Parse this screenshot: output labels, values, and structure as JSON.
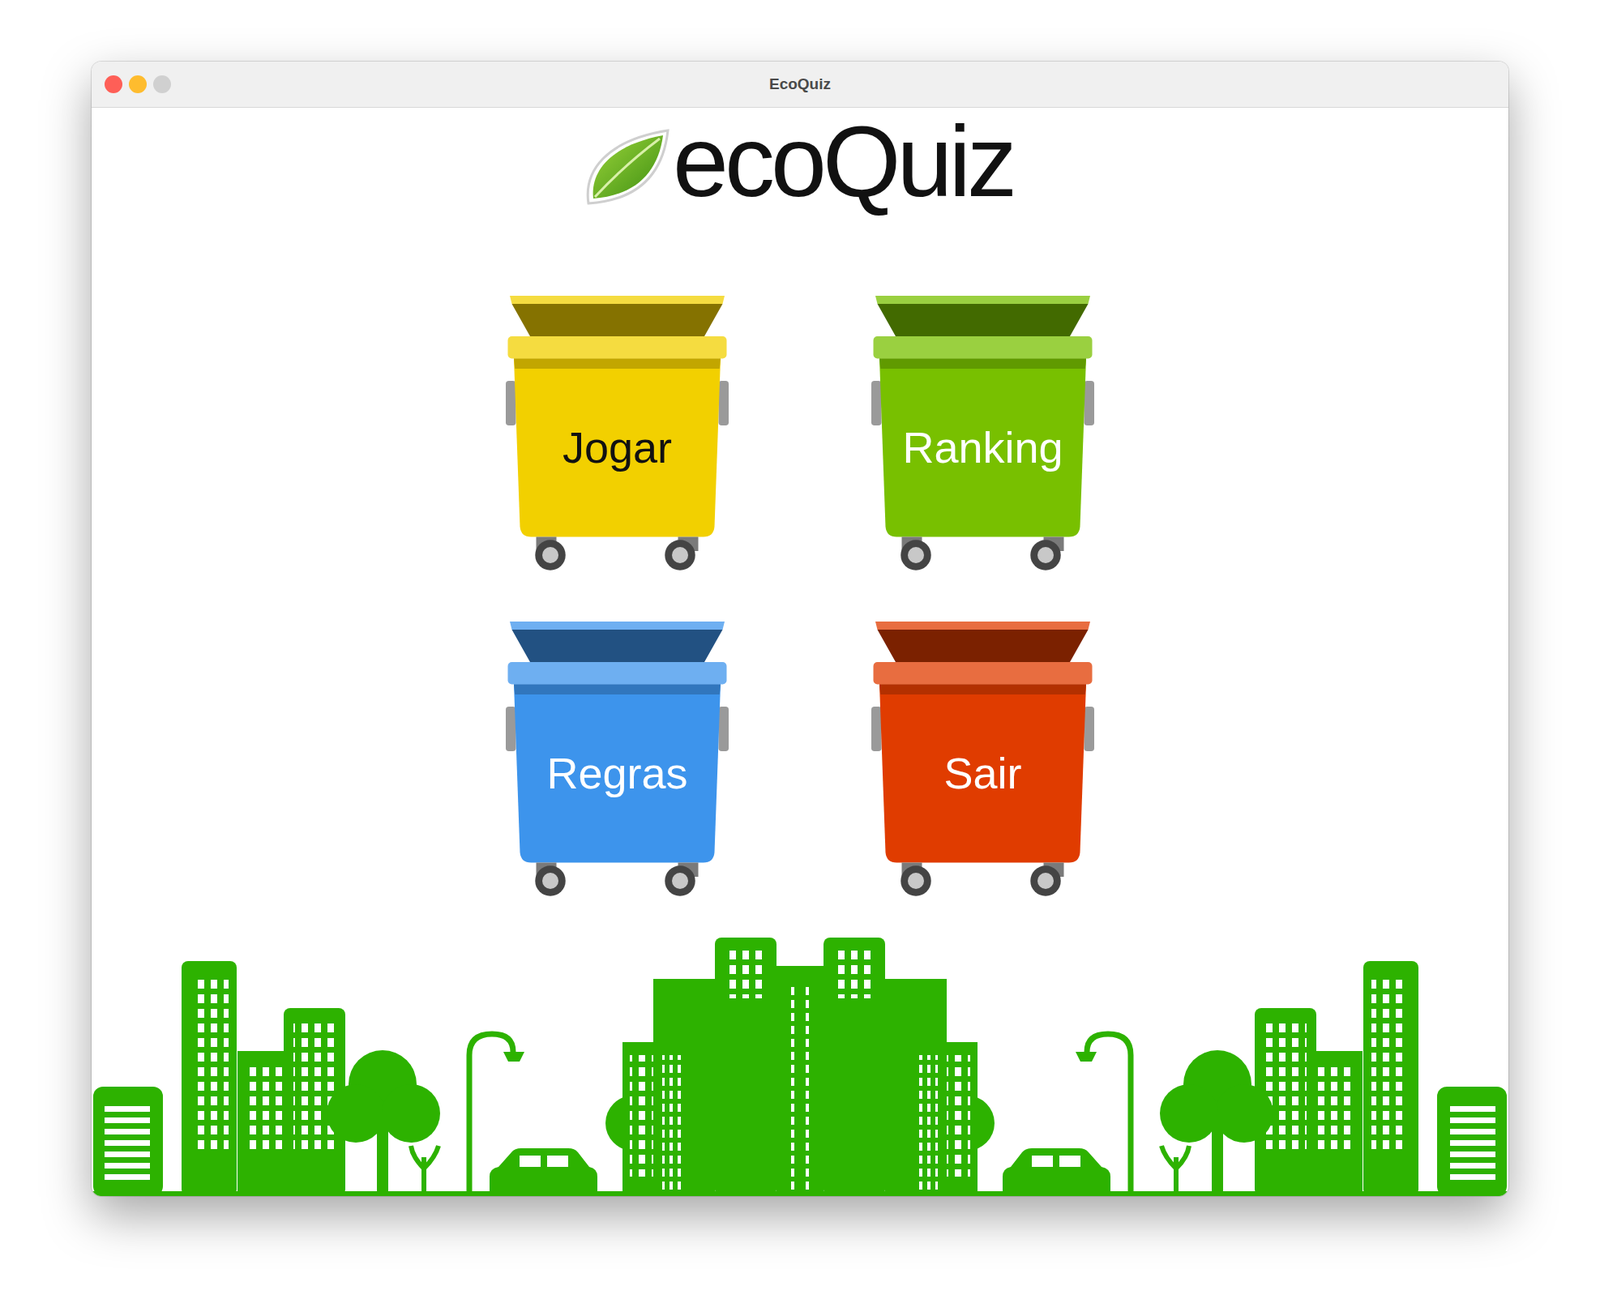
{
  "window": {
    "title": "EcoQuiz"
  },
  "logo": {
    "text": "ecoQuiz"
  },
  "menu": [
    {
      "label": "Jogar",
      "color": "#f2d000"
    },
    {
      "label": "Ranking",
      "color": "#78c000"
    },
    {
      "label": "Regras",
      "color": "#3d94ec"
    },
    {
      "label": "Sair",
      "color": "#e03c00"
    }
  ]
}
